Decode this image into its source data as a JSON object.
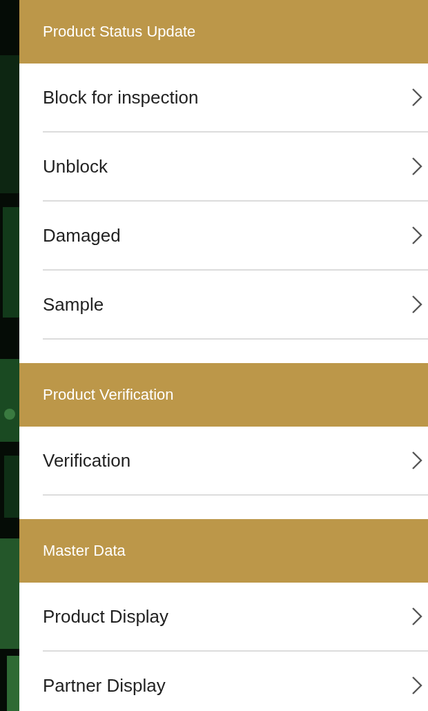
{
  "sections": [
    {
      "title": "Product Status Update",
      "items": [
        {
          "label": "Block for inspection"
        },
        {
          "label": "Unblock"
        },
        {
          "label": "Damaged"
        },
        {
          "label": "Sample"
        }
      ]
    },
    {
      "title": "Product Verification",
      "items": [
        {
          "label": "Verification"
        }
      ]
    },
    {
      "title": "Master Data",
      "items": [
        {
          "label": "Product Display"
        },
        {
          "label": "Partner Display"
        }
      ]
    }
  ]
}
